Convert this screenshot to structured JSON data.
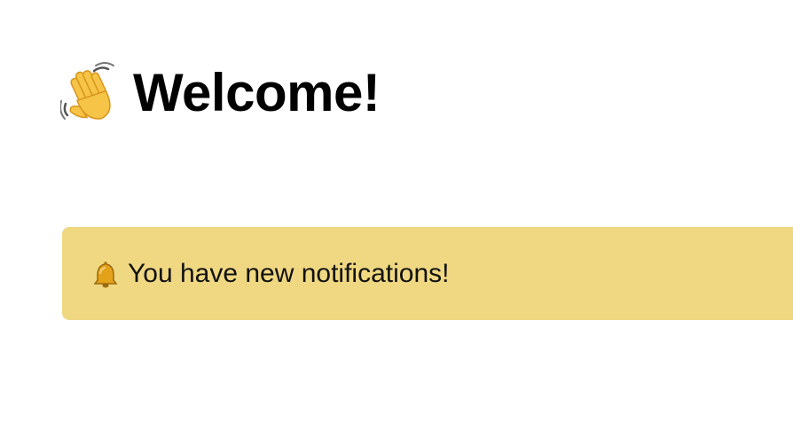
{
  "header": {
    "title": "Welcome!",
    "icon": "waving-hand-icon"
  },
  "notification": {
    "message": "You have new notifications!",
    "icon": "bell-icon",
    "background_color": "#f0d882"
  },
  "colors": {
    "page_background": "#ffffff",
    "text": "#000000",
    "banner": "#f0d882"
  }
}
